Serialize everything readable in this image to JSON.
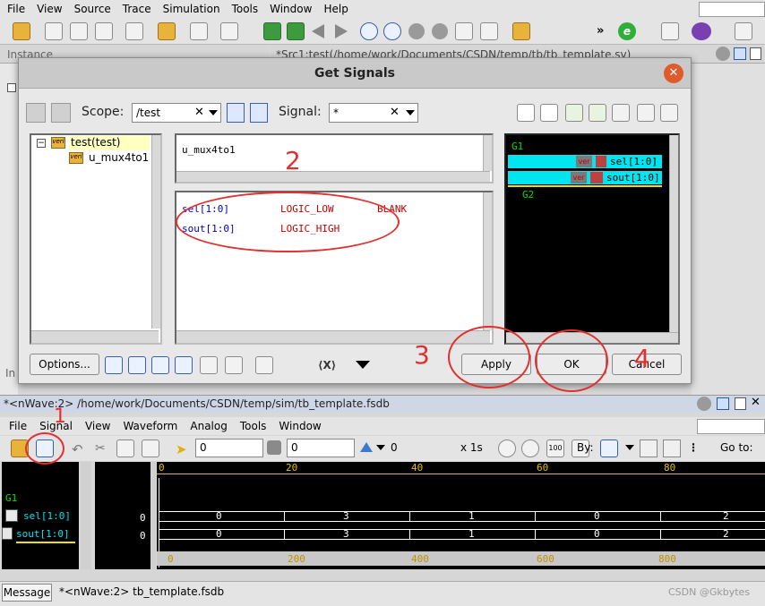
{
  "menubar": {
    "file": "File",
    "view": "View",
    "source": "Source",
    "trace": "Trace",
    "simulation": "Simulation",
    "tools": "Tools",
    "window": "Window",
    "help": "Help"
  },
  "top_pane": {
    "instance_label": "Instance",
    "src_tab": "*Src1:test(/home/work/Documents/CSDN/temp/tb/tb_template.sv)"
  },
  "dialog": {
    "title": "Get Signals",
    "scope_label": "Scope:",
    "scope_value": "/test",
    "signal_label": "Signal:",
    "signal_value": "*",
    "tree": [
      {
        "label": "test(test)",
        "badge": "veri"
      },
      {
        "label": "u_mux4to1",
        "badge": "veri"
      }
    ],
    "instance_name": "u_mux4to1",
    "signals": [
      {
        "name": "sel[1:0]",
        "type": "LOGIC_LOW",
        "extra": "BLANK"
      },
      {
        "name": "sout[1:0]",
        "type": "LOGIC_HIGH",
        "extra": ""
      }
    ],
    "groups": [
      {
        "name": "G1",
        "items": [
          {
            "badge": "ver",
            "label": "sel[1:0]"
          },
          {
            "badge": "ver",
            "label": "sout[1:0]"
          }
        ]
      },
      {
        "name": "G2",
        "items": []
      }
    ],
    "options_label": "Options...",
    "apply_label": "Apply",
    "ok_label": "OK",
    "cancel_label": "Cancel"
  },
  "annotations": {
    "one": "1",
    "two": "2",
    "three": "3",
    "four": "4"
  },
  "nwave": {
    "title": "*<nWave:2> /home/work/Documents/CSDN/temp/sim/tb_template.fsdb",
    "menu": {
      "file": "File",
      "signal": "Signal",
      "view": "View",
      "waveform": "Waveform",
      "analog": "Analog",
      "tools": "Tools",
      "window": "Window"
    },
    "cursor_value": "0",
    "marker_value": "0",
    "delta_value": "0",
    "zoom_label": "x 1s",
    "by_label": "By:",
    "goto_label": "Go to:",
    "group_name": "G1",
    "signals": [
      {
        "name": "sel[1:0]",
        "value": "0"
      },
      {
        "name": "sout[1:0]",
        "value": "0"
      }
    ],
    "top_ruler": [
      "0",
      "20",
      "40",
      "60",
      "80"
    ],
    "bottom_ruler": [
      "0",
      "200",
      "400",
      "600",
      "800"
    ],
    "waves": [
      [
        "0",
        "3",
        "1",
        "0",
        "2"
      ],
      [
        "0",
        "3",
        "1",
        "0",
        "2"
      ]
    ]
  },
  "statusbar": {
    "message_tab": "Message",
    "nwave_tab": "*<nWave:2> tb_template.fsdb",
    "watermark": "CSDN @Gkbytes"
  },
  "colors": {
    "annotation_red": "#e03030",
    "wave_bg": "#000000",
    "signal_blue": "#0000c0",
    "signal_red": "#c00000",
    "group_green": "#00e000",
    "cyan_row": "#00e5f0"
  }
}
